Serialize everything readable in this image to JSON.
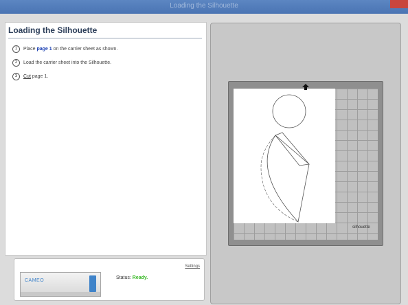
{
  "window": {
    "title": "Loading the Silhouette"
  },
  "panel": {
    "title": "Loading the Silhouette",
    "steps": [
      {
        "number": "1",
        "pre": "Place ",
        "page": "page 1",
        "post": " on the carrier sheet as shown."
      },
      {
        "number": "2",
        "text": "Load the carrier sheet into the Silhouette."
      },
      {
        "number": "3",
        "link": "Cut",
        "post": " page 1."
      }
    ]
  },
  "status": {
    "settings_label": "Settings",
    "machine_name": "CAMEO",
    "label": "Status:",
    "value": "Ready."
  },
  "preview": {
    "brand": "silhouette"
  },
  "colors": {
    "titlebar": "#4a74b3",
    "status_ready": "#38b826",
    "page_link": "#1a3fb2"
  }
}
